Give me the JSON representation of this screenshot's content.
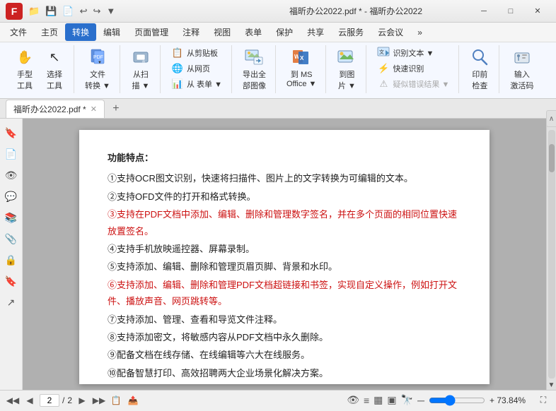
{
  "titleBar": {
    "logoText": "F",
    "title": "福昕办公2022.pdf * - 福昕办公2022",
    "quickTools": [
      "📁",
      "💾",
      "📄",
      "↩",
      "↪",
      "▼"
    ]
  },
  "menuBar": {
    "items": [
      "文件",
      "主页",
      "转换",
      "编辑",
      "页面管理",
      "注释",
      "视图",
      "表单",
      "保护",
      "共享",
      "云服务",
      "云会议",
      "»"
    ],
    "activeItem": "转换"
  },
  "ribbon": {
    "groups": [
      {
        "name": "手型/选择",
        "items": [
          {
            "icon": "✋",
            "label": "手型\n工具"
          },
          {
            "icon": "↖",
            "label": "选择\n工具"
          }
        ]
      },
      {
        "name": "文件转换",
        "items": [
          {
            "icon": "📄",
            "label": "文件\n转换 ▼"
          }
        ]
      },
      {
        "name": "从扫描",
        "items": [
          {
            "icon": "🖨",
            "label": "从扫\n描 ▼"
          }
        ]
      },
      {
        "name": "剪贴板/网页",
        "smallItems": [
          {
            "icon": "📋",
            "label": "从剪贴板"
          },
          {
            "icon": "🌐",
            "label": "从网页"
          },
          {
            "icon": "📊",
            "label": "从 表单 ▼"
          }
        ]
      },
      {
        "name": "导出全部图像",
        "items": [
          {
            "icon": "🖼",
            "label": "导出全\n部图像"
          }
        ]
      },
      {
        "name": "到MS Office",
        "items": [
          {
            "icon": "📝",
            "label": "到 MS\nOffice ▼"
          }
        ]
      },
      {
        "name": "到图片",
        "items": [
          {
            "icon": "🖼",
            "label": "到图\n片 ▼"
          }
        ]
      },
      {
        "name": "识别",
        "smallItems": [
          {
            "icon": "🔍",
            "label": "识别文本 ▼"
          },
          {
            "icon": "⚡",
            "label": "快速识别"
          },
          {
            "icon": "⚠",
            "label": "疑似错误结果 ▼"
          }
        ]
      },
      {
        "name": "印前检查",
        "items": [
          {
            "icon": "🔎",
            "label": "印前\n检查"
          }
        ]
      },
      {
        "name": "输入激活码",
        "items": [
          {
            "icon": "🔑",
            "label": "输入\n激活码"
          }
        ]
      }
    ]
  },
  "tabs": {
    "openTabs": [
      {
        "label": "福昕办公2022.pdf *",
        "active": true
      }
    ],
    "addLabel": "+"
  },
  "sidebar": {
    "icons": [
      {
        "icon": "🔖",
        "name": "bookmark",
        "active": false
      },
      {
        "icon": "📄",
        "name": "pages",
        "active": false
      },
      {
        "icon": "👁",
        "name": "signatures",
        "active": false
      },
      {
        "icon": "💬",
        "name": "comments",
        "active": false
      },
      {
        "icon": "📚",
        "name": "layers",
        "active": false
      },
      {
        "icon": "📎",
        "name": "attachments",
        "active": true
      },
      {
        "icon": "🔒",
        "name": "security",
        "active": false
      },
      {
        "icon": "🔖",
        "name": "bookmark2",
        "active": false
      },
      {
        "icon": "↗",
        "name": "navigation",
        "active": false
      }
    ]
  },
  "documentContent": {
    "title": "功能特点：",
    "items": [
      {
        "num": "①",
        "text": "支持OCR图文识别，快速将扫描件、图片上的文字转换为可编辑的文本。",
        "red": false
      },
      {
        "num": "②",
        "text": "支持OFD文件的打开和格式转换。",
        "red": false
      },
      {
        "num": "③",
        "text": "支持在PDF文档中添加、编辑、删除和管理数字签名，并在多个页面的相同位置快速放置签名。",
        "red": true
      },
      {
        "num": "④",
        "text": "支持手机放映遥控器、屏幕录制。",
        "red": false
      },
      {
        "num": "⑤",
        "text": "支持添加、编辑、删除和管理页眉页脚、背景和水印。",
        "red": false
      },
      {
        "num": "⑥",
        "text": "支持添加、编辑、删除和管理PDF文档超链接和书签，实现自定义操作，例如打开文件、播放声音、网页跳转等。",
        "red": true
      },
      {
        "num": "⑦",
        "text": "支持添加、管理、查看和导览文件注释。",
        "red": false
      },
      {
        "num": "⑧",
        "text": "支持添加密文，将敏感内容从PDF文档中永久删除。",
        "red": false
      },
      {
        "num": "⑨",
        "text": "配备文档在线存储、在线编辑等六大在线服务。",
        "red": false
      },
      {
        "num": "⑩",
        "text": "配备智慧打印、高效招聘两大企业场景化解决方案。",
        "red": false
      }
    ]
  },
  "statusBar": {
    "currentPage": "2",
    "totalPages": "2",
    "zoomPercent": "+ 73.84%",
    "statusIcons": [
      "👁",
      "≡",
      "▦",
      "▣",
      "🔭"
    ]
  }
}
